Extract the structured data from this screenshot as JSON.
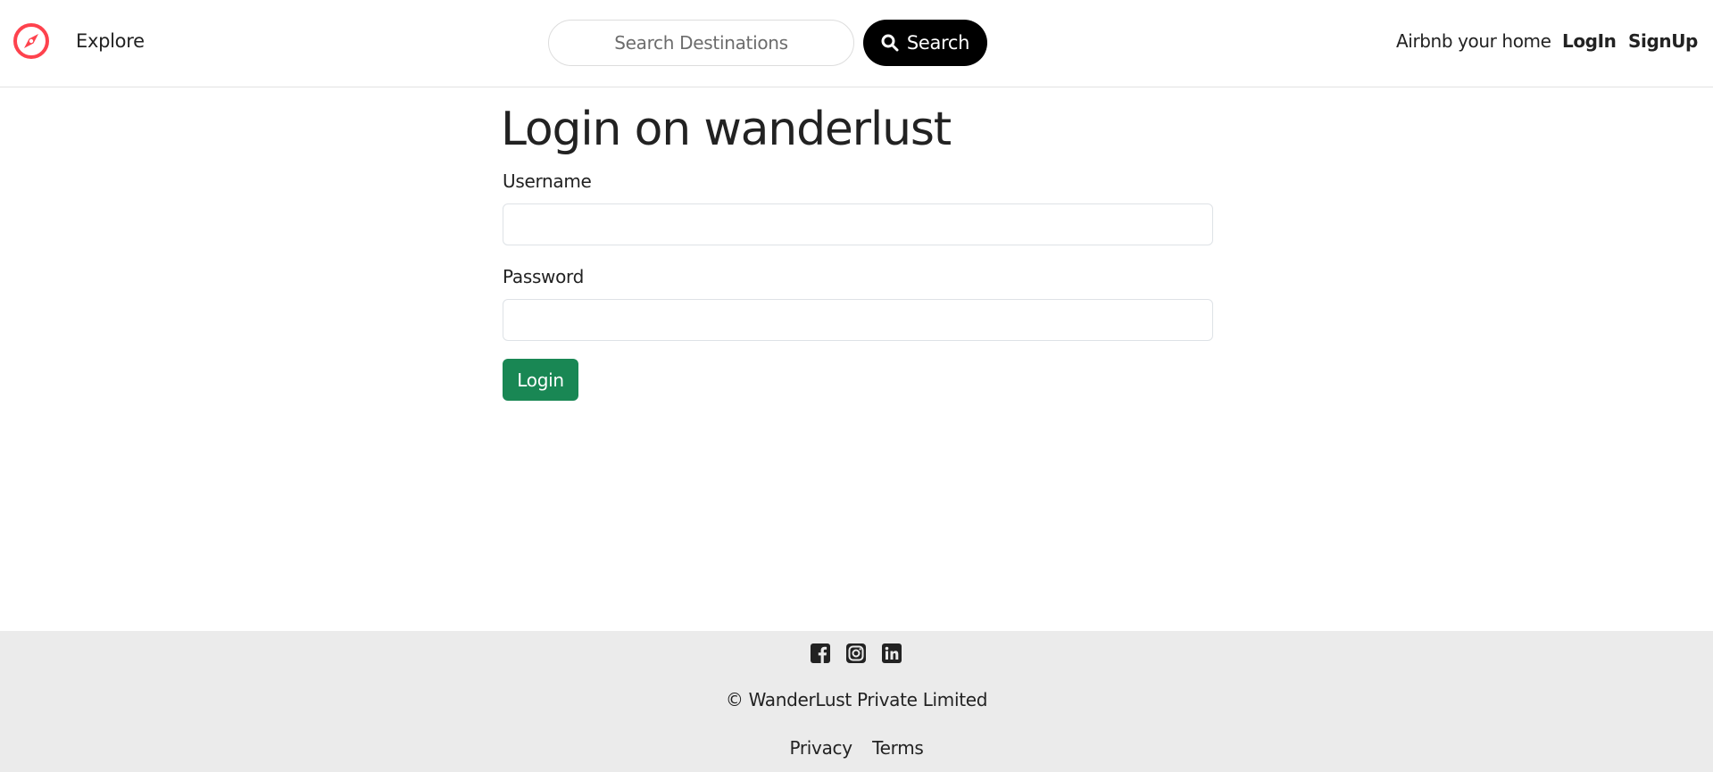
{
  "navbar": {
    "logo_icon": "compass-icon",
    "brand_color": "#fe424d",
    "explore_label": "Explore",
    "search": {
      "placeholder": "Search Destinations",
      "value": "",
      "button_label": "Search",
      "button_icon": "search-icon"
    },
    "host_label": "Airbnb your home",
    "login_label": "LogIn",
    "signup_label": "SignUp"
  },
  "main": {
    "title": "Login on wanderlust",
    "username": {
      "label": "Username",
      "value": ""
    },
    "password": {
      "label": "Password",
      "value": ""
    },
    "submit_label": "Login",
    "submit_color": "#198754"
  },
  "footer": {
    "social_icons": [
      "facebook-icon",
      "instagram-icon",
      "linkedin-icon"
    ],
    "copyright": "© WanderLust Private Limited",
    "links": [
      "Privacy",
      "Terms"
    ],
    "background": "#ebebeb"
  }
}
